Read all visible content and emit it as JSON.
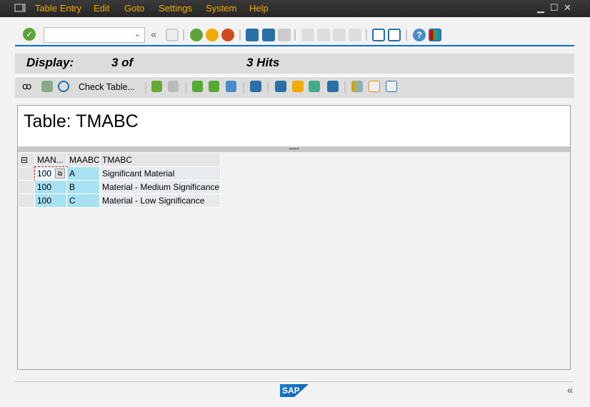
{
  "menu": {
    "items": [
      "Table Entry",
      "Edit",
      "Goto",
      "Settings",
      "System",
      "Help"
    ]
  },
  "toolbar": {
    "command_field": "",
    "colors": {
      "accent": "#0a6ed1",
      "menu_text": "#f0ab00"
    }
  },
  "title": {
    "label": "Display:",
    "count": "3 of",
    "hits": "3 Hits"
  },
  "app_toolbar": {
    "check_table": "Check Table..."
  },
  "table": {
    "title": "Table: TMABC",
    "columns": [
      "MAN...",
      "MAABC",
      "TMABC"
    ],
    "rows": [
      [
        "100",
        "A",
        "Significant Material"
      ],
      [
        "100",
        "B",
        "Material - Medium Significance"
      ],
      [
        "100",
        "C",
        "Material - Low Significance"
      ]
    ]
  },
  "footer": {
    "logo": "SAP"
  }
}
